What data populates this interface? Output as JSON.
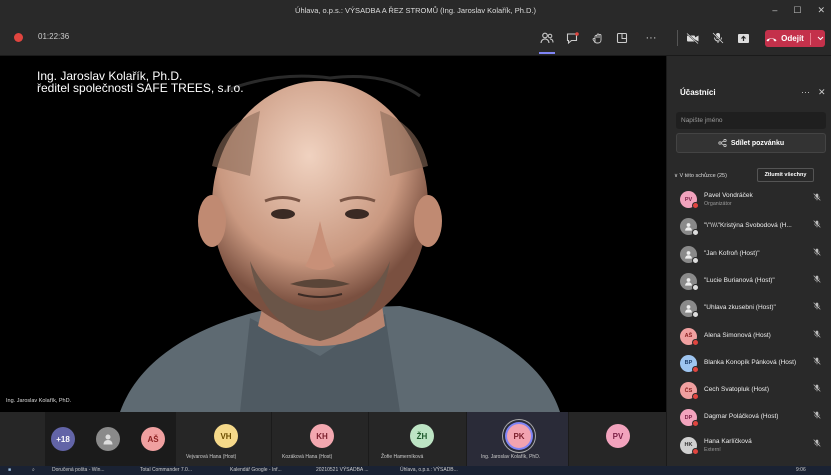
{
  "window": {
    "title": "Úhlava, o.p.s.: VÝSADBA A ŘEZ STROMŮ (Ing. Jaroslav Kolařík, Ph.D.)",
    "min": "–",
    "max": "☐",
    "close": "✕"
  },
  "toolbar": {
    "timer": "01:22:36",
    "leave_label": "Odejít",
    "more": "···"
  },
  "video": {
    "caption_line1": "Ing. Jaroslav Kolařík, Ph.D.",
    "caption_line2": "ředitel společnosti SAFE TREES, s.r.o.",
    "speaker_name": "Ing. Jaroslav Kolařík, PhD."
  },
  "strip": {
    "overflow": "+18",
    "tiles": [
      {
        "initials": "AŠ",
        "name": "",
        "color": "#f0a0a0",
        "fg": "#8a1f1f"
      },
      {
        "initials": "VH",
        "name": "Vejvarová Hana (Host)",
        "color": "#f5d98a",
        "fg": "#6b4d00"
      },
      {
        "initials": "KH",
        "name": "Kozáková Hana (Host)",
        "color": "#f3a8b0",
        "fg": "#7a1f2c"
      },
      {
        "initials": "ŽH",
        "name": "Žofie Hamerníková",
        "color": "#bde4c4",
        "fg": "#1f5a2c"
      },
      {
        "initials": "PK",
        "name": "Ing. Jaroslav Kolařík, PhD.",
        "color": "#f2a3b0",
        "fg": "#7a1f2c"
      },
      {
        "initials": "PV",
        "name": "",
        "color": "#f2a3bd",
        "fg": "#7a1f45"
      }
    ]
  },
  "panel": {
    "title": "Účastníci",
    "more": "···",
    "close": "✕",
    "search_placeholder": "Napište jméno",
    "share_label": "Sdílet pozvánku",
    "section_label": "∨ V této schůzce (25)",
    "mute_all": "Ztlumit všechny",
    "participants": [
      {
        "initials": "PV",
        "name": "Pavel Vondráček",
        "role": "Organizátor",
        "color": "#f2a3bd",
        "fg": "#7a1f45"
      },
      {
        "initials": "",
        "name": "\"\\\"\\\\\\\\\"Kristýna Svobodová (H...",
        "role": "",
        "color": "#8a8a8a",
        "fg": "#fff"
      },
      {
        "initials": "",
        "name": "\"Jan Kofroň (Host)\"",
        "role": "",
        "color": "#8a8a8a",
        "fg": "#fff"
      },
      {
        "initials": "",
        "name": "\"Lucie Burianová (Host)\"",
        "role": "",
        "color": "#8a8a8a",
        "fg": "#fff"
      },
      {
        "initials": "",
        "name": "\"Uhlava zkusebni (Host)\"",
        "role": "",
        "color": "#8a8a8a",
        "fg": "#fff"
      },
      {
        "initials": "AŠ",
        "name": "Alena Šimonová (Host)",
        "role": "",
        "color": "#f0a0a0",
        "fg": "#8a1f1f"
      },
      {
        "initials": "BP",
        "name": "Blanka Konopík Pánková (Host)",
        "role": "",
        "color": "#9ec5f0",
        "fg": "#1f3f6b"
      },
      {
        "initials": "ČS",
        "name": "Čech Svatopluk (Host)",
        "role": "",
        "color": "#f0a0a0",
        "fg": "#8a1f1f"
      },
      {
        "initials": "DP",
        "name": "Dagmar Poláčková (Host)",
        "role": "",
        "color": "#f2a3bd",
        "fg": "#7a1f45"
      },
      {
        "initials": "HK",
        "name": "Hana Karlíčková",
        "role": "Externí",
        "color": "#d0d0d0",
        "fg": "#333"
      }
    ]
  },
  "taskbar": {
    "items": [
      "Doručená pošta - Win...",
      "Total Commander 7.0...",
      "Kalendář Google - Inf...",
      "20210521 VÝSADBA ...",
      "Úhlava, o.p.s.: VÝSADB..."
    ],
    "clock": "9:06"
  }
}
